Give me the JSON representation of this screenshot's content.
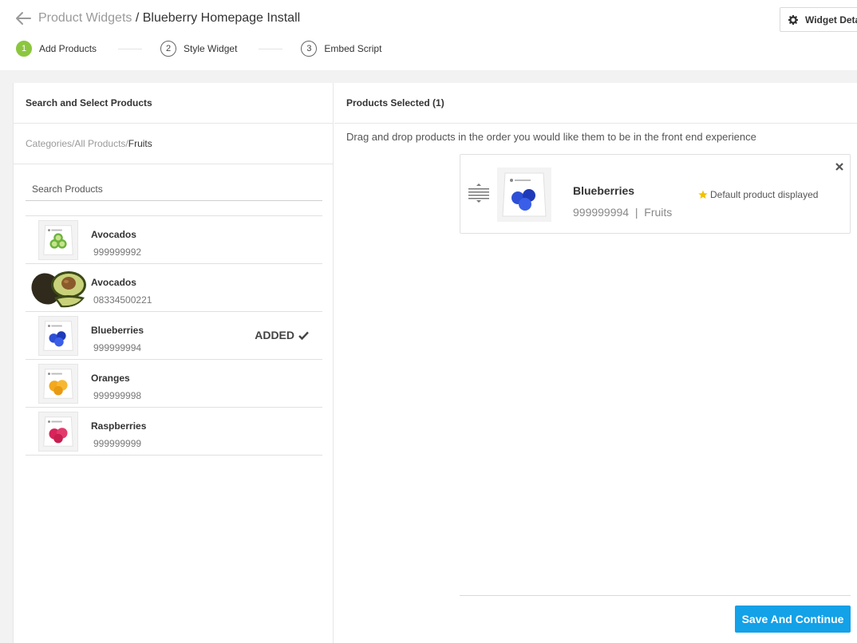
{
  "header": {
    "breadcrumb_parent": "Product Widgets",
    "breadcrumb_separator": " / ",
    "breadcrumb_current": "Blueberry Homepage Install",
    "widget_details_label": "Widget Details"
  },
  "steps": [
    {
      "number": "1",
      "label": "Add Products",
      "active": true
    },
    {
      "number": "2",
      "label": "Style Widget",
      "active": false
    },
    {
      "number": "3",
      "label": "Embed Script",
      "active": false
    }
  ],
  "left_panel": {
    "title": "Search and Select Products",
    "crumbs": {
      "categories": "Categories",
      "sep": " / ",
      "all_products": "All Products",
      "current": "Fruits"
    },
    "search_placeholder": "Search Products",
    "added_label": "ADDED",
    "products": [
      {
        "name": "Avocados",
        "sku": "999999992",
        "image": "kiwi-pouch",
        "added": false
      },
      {
        "name": "Avocados",
        "sku": "08334500221",
        "image": "avocado-photo",
        "added": false
      },
      {
        "name": "Blueberries",
        "sku": "999999994",
        "image": "blueberry-pouch",
        "added": true
      },
      {
        "name": "Oranges",
        "sku": "999999998",
        "image": "orange-pouch",
        "added": false
      },
      {
        "name": "Raspberries",
        "sku": "999999999",
        "image": "raspberry-pouch",
        "added": false
      }
    ]
  },
  "right_panel": {
    "title": "Products Selected (1)",
    "instruction": "Drag and drop products in the order you would like them to be in the front end experience",
    "selected": {
      "name": "Blueberries",
      "sku": "999999994",
      "meta_sep": "  |  ",
      "category": "Fruits",
      "default_label": "Default product displayed"
    },
    "save_label": "Save And Continue"
  },
  "colors": {
    "step_active": "#8cc63f",
    "save_button": "#13a1e8",
    "star": "#f2c200",
    "blueberry": "#2d4fd6",
    "orange": "#f3a81d",
    "raspberry": "#d8245a",
    "kiwi": "#6db33f"
  }
}
